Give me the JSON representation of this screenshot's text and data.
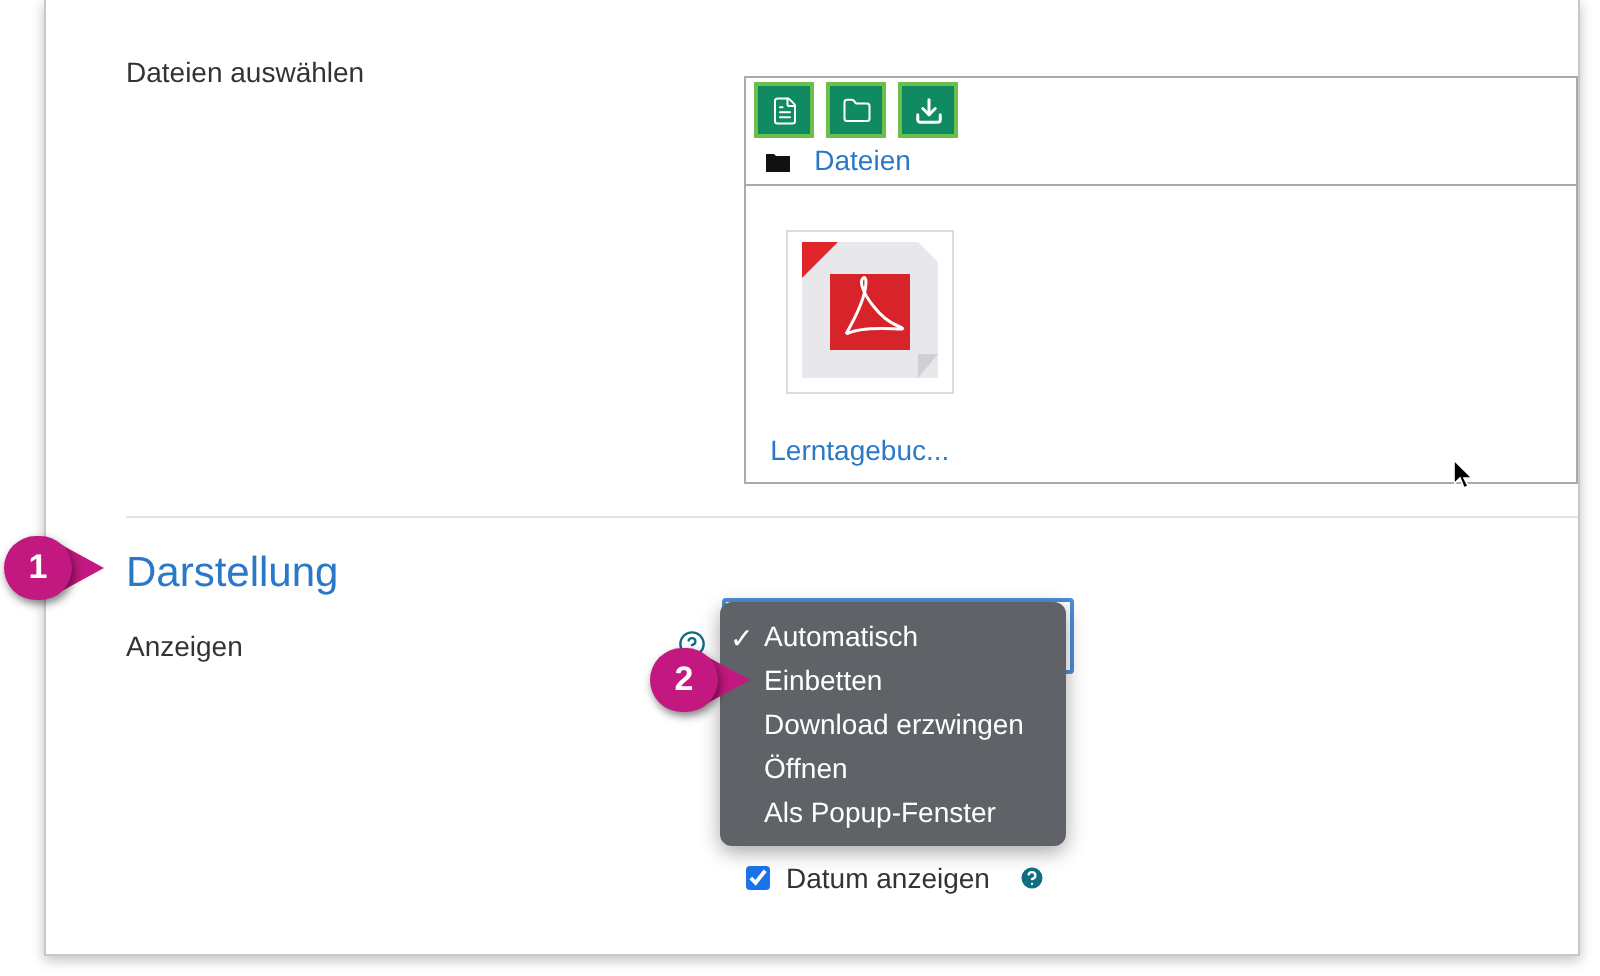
{
  "files_field": {
    "label": "Dateien auswählen",
    "toolbar": [
      {
        "kind": "file"
      },
      {
        "kind": "folder"
      },
      {
        "kind": "download"
      }
    ],
    "breadcrumb": "Dateien",
    "files": [
      {
        "name": "Lerntagebuc..."
      }
    ]
  },
  "section": {
    "title": "Darstellung",
    "callout": "1"
  },
  "display_field": {
    "label": "Anzeigen",
    "callout": "2",
    "check_mark": "✓",
    "options": [
      {
        "label": "Automatisch",
        "selected": true
      },
      {
        "label": "Einbetten",
        "selected": false
      },
      {
        "label": "Download erzwingen",
        "selected": false
      },
      {
        "label": "Öffnen",
        "selected": false
      },
      {
        "label": "Als Popup-Fenster",
        "selected": false
      }
    ]
  },
  "date_checkbox": {
    "label": "Datum anzeigen",
    "checked": true
  }
}
